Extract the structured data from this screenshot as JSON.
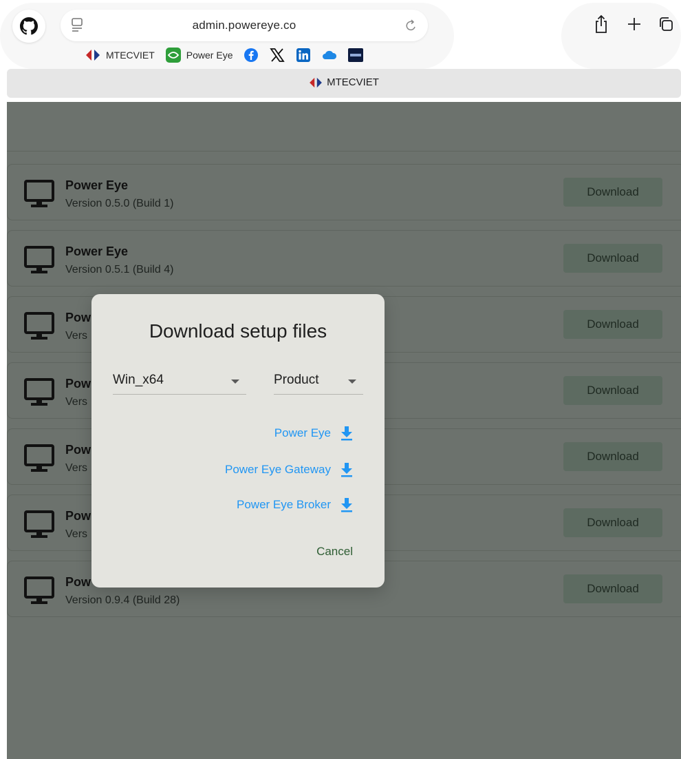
{
  "browser": {
    "url": "admin.powereye.co",
    "favorites": [
      {
        "label": "MTECVIET",
        "icon": "mtecviet-logo-icon"
      },
      {
        "label": "Power Eye",
        "icon": "power-eye-logo-icon"
      },
      {
        "label": "",
        "icon": "facebook-icon"
      },
      {
        "label": "",
        "icon": "x-icon"
      },
      {
        "label": "",
        "icon": "linkedin-icon"
      },
      {
        "label": "",
        "icon": "onedrive-cloud-icon"
      },
      {
        "label": "",
        "icon": "cnbc-icon"
      }
    ],
    "tab_title": "MTECVIET"
  },
  "releases": [
    {
      "title": "Power Eye",
      "version": "Version 0.5.0 (Build 1)",
      "button": "Download"
    },
    {
      "title": "Power Eye",
      "version": "Version 0.5.1 (Build 4)",
      "button": "Download"
    },
    {
      "title": "Pow",
      "version": "Vers",
      "button": "Download"
    },
    {
      "title": "Pow",
      "version": "Vers",
      "button": "Download"
    },
    {
      "title": "Pow",
      "version": "Vers",
      "button": "Download"
    },
    {
      "title": "Pow",
      "version": "Vers",
      "button": "Download"
    },
    {
      "title": "Pow",
      "version": "Version 0.9.4 (Build 28)",
      "button": "Download"
    }
  ],
  "dialog": {
    "title": "Download setup files",
    "platform_select": "Win_x64",
    "type_select": "Product",
    "links": [
      {
        "label": "Power Eye",
        "icon": "download-arrow-icon"
      },
      {
        "label": "Power Eye Gateway",
        "icon": "download-arrow-icon"
      },
      {
        "label": "Power Eye Broker",
        "icon": "download-arrow-icon"
      }
    ],
    "cancel": "Cancel"
  },
  "colors": {
    "scrim": "#6c726d",
    "dialog_bg": "#e4e4df",
    "link": "#2196f3",
    "cancel": "#2e5d33",
    "button_bg": "#5d6b61"
  }
}
